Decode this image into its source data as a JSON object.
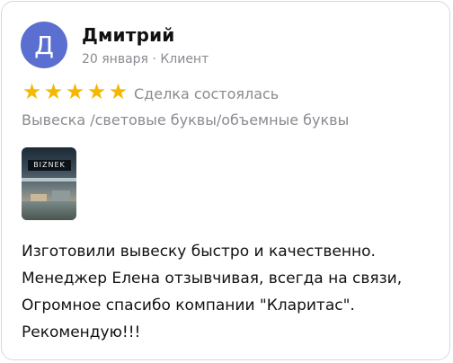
{
  "review": {
    "author": {
      "initial": "Д",
      "name": "Дмитрий",
      "meta": "20 января · Клиент",
      "avatar_color": "#5b6fd0"
    },
    "rating": {
      "stars": 5,
      "max_stars": 5,
      "star_color": "#f5b800",
      "status": "Сделка состоялась"
    },
    "category": "Вывеска /световые буквы/объемные буквы",
    "photo": {
      "icon": "storefront-photo-thumbnail",
      "sign_text": "BIZNEK"
    },
    "text_lines": [
      "Изготовили вывеску быстро и качественно.",
      "Менеджер Елена отзывчивая, всегда на связи,",
      "Огромное спасибо компании \"Кларитас\".",
      "Рекомендую!!!"
    ]
  }
}
